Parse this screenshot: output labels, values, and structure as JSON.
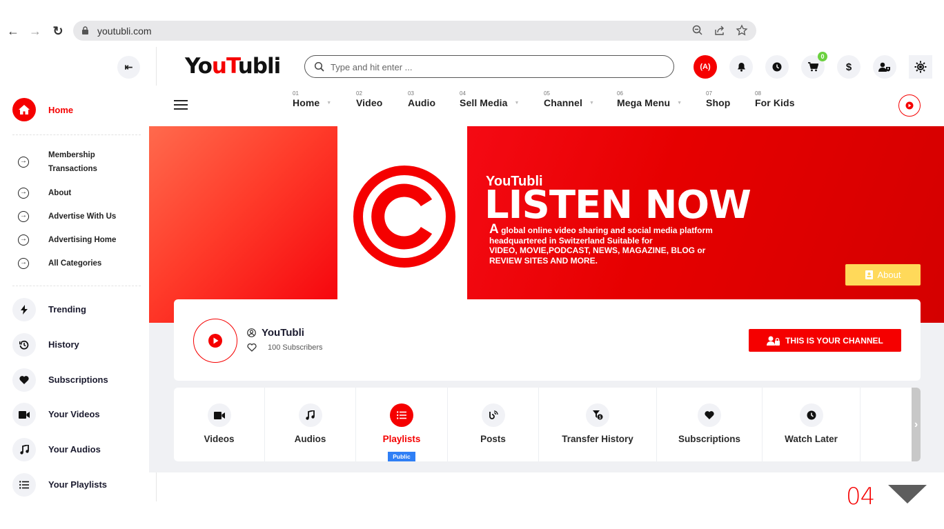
{
  "browser": {
    "url": "youtubli.com",
    "icons": [
      "back-icon",
      "forward-icon",
      "reload-icon",
      "lock-icon",
      "zoom-out-icon",
      "share-icon",
      "bookmark-star-icon"
    ]
  },
  "header": {
    "logo": {
      "part1": "Yo",
      "part2": "u",
      "part3": "T",
      "part4": "ubli"
    },
    "search_placeholder": "Type and hit enter ...",
    "cart_count": "0",
    "live_label": "(A)",
    "accent_color": "#f50000"
  },
  "topnav": {
    "items": [
      {
        "num": "01",
        "label": "Home",
        "dropdown": true
      },
      {
        "num": "02",
        "label": "Video",
        "dropdown": false
      },
      {
        "num": "03",
        "label": "Audio",
        "dropdown": false
      },
      {
        "num": "04",
        "label": "Sell Media",
        "dropdown": true
      },
      {
        "num": "05",
        "label": "Channel",
        "dropdown": true
      },
      {
        "num": "06",
        "label": "Mega Menu",
        "dropdown": true
      },
      {
        "num": "07",
        "label": "Shop",
        "dropdown": false
      },
      {
        "num": "08",
        "label": "For Kids",
        "dropdown": false
      }
    ]
  },
  "sidebar": {
    "home": "Home",
    "links": [
      {
        "line1": "Membership",
        "line2": "Transactions"
      },
      {
        "line1": "About"
      },
      {
        "line1": "Advertise With Us"
      },
      {
        "line1": "Advertising Home"
      },
      {
        "line1": "All Categories"
      }
    ],
    "items": [
      {
        "label": "Trending",
        "icon": "bolt-icon"
      },
      {
        "label": "History",
        "icon": "history-icon"
      },
      {
        "label": "Subscriptions",
        "icon": "heart-icon"
      },
      {
        "label": "Your Videos",
        "icon": "video-camera-icon"
      },
      {
        "label": "Your Audios",
        "icon": "music-note-icon"
      },
      {
        "label": "Your Playlists",
        "icon": "list-icon"
      }
    ]
  },
  "banner": {
    "brand": "YouTubli",
    "title": "LISTEN NOW",
    "desc_first": "A",
    "desc_line1": " global online video sharing and social media platform",
    "desc_line2": "headquartered in Switzerland Suitable for",
    "desc_line3": "VIDEO, MOVIE,PODCAST, NEWS, MAGAZINE, BLOG or",
    "desc_line4": "REVIEW SITES AND MORE.",
    "about_label": "About"
  },
  "channel": {
    "name": "YouTubli",
    "subscribers": "100 Subscribers",
    "owner_button": "THIS IS YOUR CHANNEL"
  },
  "tabs": {
    "items": [
      {
        "label": "Videos",
        "icon": "video-camera-icon"
      },
      {
        "label": "Audios",
        "icon": "music-note-icon"
      },
      {
        "label": "Playlists",
        "icon": "list-icon",
        "active": true,
        "badge": "Public"
      },
      {
        "label": "Posts",
        "icon": "blog-icon"
      },
      {
        "label": "Transfer History",
        "icon": "filter-coin-icon"
      },
      {
        "label": "Subscriptions",
        "icon": "heart-icon"
      },
      {
        "label": "Watch Later",
        "icon": "clock-icon"
      }
    ]
  },
  "pagination": {
    "current": "04"
  }
}
